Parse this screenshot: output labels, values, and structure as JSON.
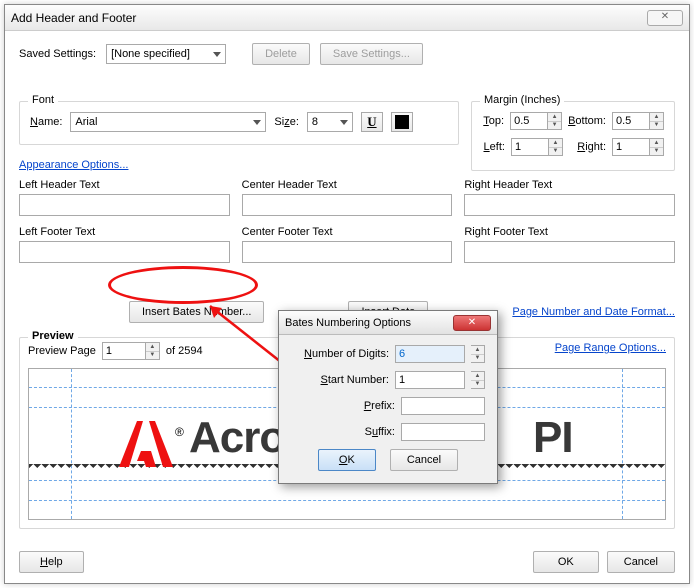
{
  "window": {
    "title": "Add Header and Footer",
    "close": "✕"
  },
  "saved": {
    "label": "Saved Settings:",
    "value": "[None specified]",
    "delete": "Delete",
    "save": "Save Settings..."
  },
  "font": {
    "legend": "Font",
    "name_label": "Name:",
    "name_value": "Arial",
    "size_label": "Size:",
    "size_value": "8",
    "underline_tip": "U",
    "color": "#000000"
  },
  "margin": {
    "legend": "Margin (Inches)",
    "top_label": "Top:",
    "top_value": "0.5",
    "bottom_label": "Bottom:",
    "bottom_value": "0.5",
    "left_label": "Left:",
    "left_value": "1",
    "right_label": "Right:",
    "right_value": "1"
  },
  "appearance_link": "Appearance Options...",
  "fields": {
    "lh": "Left Header Text",
    "ch": "Center Header Text",
    "rh": "Right Header Text",
    "lf": "Left Footer Text",
    "cf": "Center Footer Text",
    "rf": "Right Footer Text"
  },
  "actions": {
    "insert_bates": "Insert Bates Number...",
    "insert_date": "Insert Date",
    "page_format_link": "Page Number and Date Format..."
  },
  "preview": {
    "legend": "Preview",
    "page_label": "Preview Page",
    "page_value": "1",
    "of_label": "of 2594",
    "range_link": "Page Range Options...",
    "big1": "Acro",
    "big2": "PI"
  },
  "buttons": {
    "help": "Help",
    "ok": "OK",
    "cancel": "Cancel"
  },
  "modal": {
    "title": "Bates Numbering Options",
    "digits_label": "Number of Digits:",
    "digits_value": "6",
    "start_label": "Start Number:",
    "start_value": "1",
    "prefix_label": "Prefix:",
    "prefix_value": "",
    "suffix_label": "Suffix:",
    "suffix_value": "",
    "ok": "OK",
    "cancel": "Cancel"
  }
}
